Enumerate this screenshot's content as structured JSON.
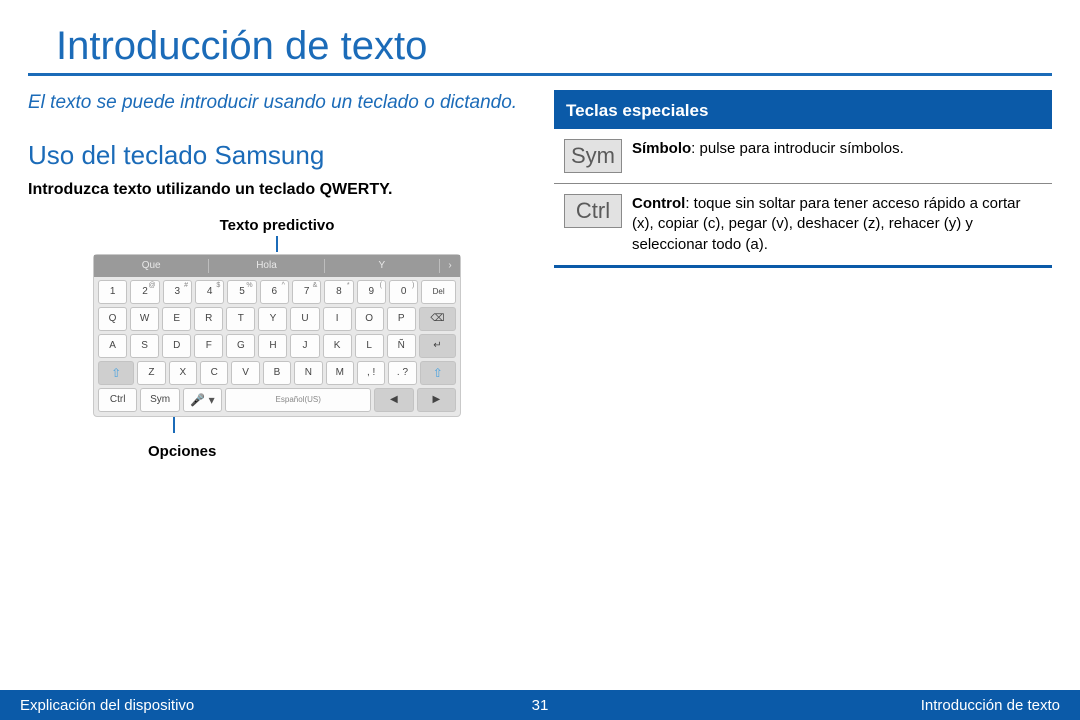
{
  "title": "Introducción de texto",
  "intro": "El texto se puede introducir usando un teclado o dictando.",
  "section": {
    "heading": "Uso del teclado Samsung",
    "lead": "Introduzca texto utilizando un teclado QWERTY.",
    "callout_top": "Texto predictivo",
    "callout_bottom": "Opciones"
  },
  "keyboard": {
    "predictions": [
      "Que",
      "Hola",
      "Y"
    ],
    "row1": [
      {
        "k": "1",
        "s": ""
      },
      {
        "k": "2",
        "s": "@"
      },
      {
        "k": "3",
        "s": "#"
      },
      {
        "k": "4",
        "s": "$"
      },
      {
        "k": "5",
        "s": "%"
      },
      {
        "k": "6",
        "s": "^"
      },
      {
        "k": "7",
        "s": "&"
      },
      {
        "k": "8",
        "s": "*"
      },
      {
        "k": "9",
        "s": "("
      },
      {
        "k": "0",
        "s": ")"
      }
    ],
    "row1_del": "Del",
    "row2": [
      "Q",
      "W",
      "E",
      "R",
      "T",
      "Y",
      "U",
      "I",
      "O",
      "P"
    ],
    "row3": [
      "A",
      "S",
      "D",
      "F",
      "G",
      "H",
      "J",
      "K",
      "L",
      "Ñ"
    ],
    "row4": [
      "Z",
      "X",
      "C",
      "V",
      "B",
      "N",
      "M"
    ],
    "row4_punct1": ", !",
    "row4_punct2": ". ?",
    "row5": {
      "ctrl": "Ctrl",
      "sym": "Sym",
      "space": "Español(US)"
    }
  },
  "special": {
    "header": "Teclas especiales",
    "rows": [
      {
        "icon": "Sym",
        "bold": "Símbolo",
        "text": ": pulse para introducir símbolos."
      },
      {
        "icon": "Ctrl",
        "bold": "Control",
        "text": ": toque sin soltar para tener acceso rápido a cortar (x), copiar (c), pegar (v), deshacer (z), rehacer (y) y seleccionar todo (a)."
      }
    ]
  },
  "footer": {
    "left": "Explicación del dispositivo",
    "page": "31",
    "right": "Introducción de texto"
  }
}
